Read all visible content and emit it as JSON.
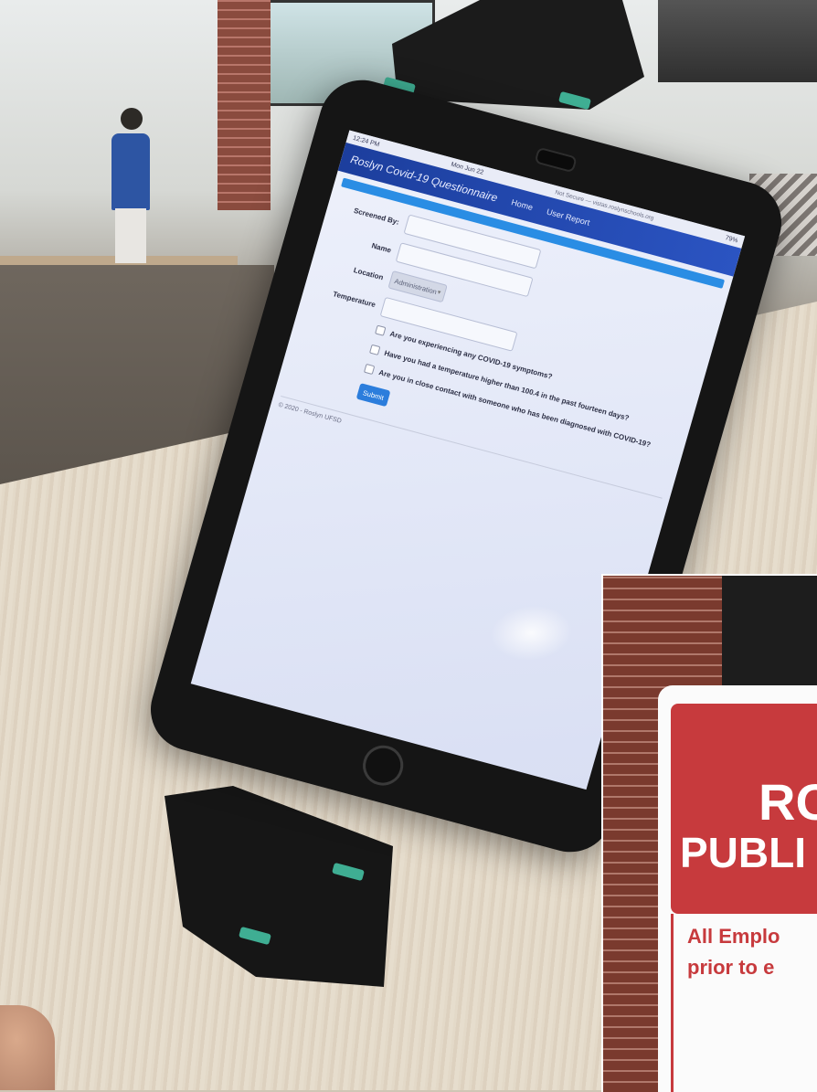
{
  "status_bar": {
    "time": "12:24 PM",
    "date": "Mon Jun 22",
    "url": "Not Secure — vistas.roslynschools.org",
    "battery": "79%"
  },
  "navbar": {
    "brand": "Roslyn Covid-19 Questionnaire",
    "links": [
      "Home",
      "User Report"
    ]
  },
  "form": {
    "screened_by_label": "Screened By:",
    "name_label": "Name",
    "location_label": "Location",
    "location_value": "Administration",
    "temperature_label": "Temperature",
    "questions": [
      "Are you experiencing any COVID-19 symptoms?",
      "Have you had a temperature higher than 100.4 in the past fourteen days?",
      "Are you in close contact with someone who has been diagnosed with COVID-19?"
    ],
    "submit_label": "Submit"
  },
  "footer": {
    "text": "© 2020 - Roslyn UFSD"
  },
  "sign": {
    "line1": "RO",
    "line2": "PUBLI",
    "line3": "All Emplo",
    "line4": "prior to e"
  },
  "colors": {
    "navbar": "#2b54c2",
    "accent": "#2a8de4",
    "submit": "#2b7ddc",
    "sign_red": "#c73a3d"
  }
}
